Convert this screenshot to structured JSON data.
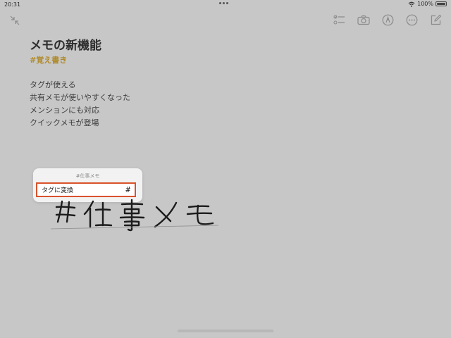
{
  "status_bar": {
    "time": "20:31",
    "battery_text": "100%",
    "icons": [
      "wifi-icon",
      "battery-icon"
    ]
  },
  "toolbar": {
    "icons": [
      "collapse-icon",
      "checklist-icon",
      "camera-icon",
      "markup-pen-icon",
      "more-icon",
      "compose-icon"
    ]
  },
  "note": {
    "title": "メモの新機能",
    "tag": "#覚え書き",
    "lines": [
      "タグが使える",
      "共有メモが使いやすくなった",
      "メンションにも対応",
      "クイックメモが登場"
    ]
  },
  "popup": {
    "preview_text": "#仕事メモ",
    "action_label": "タグに変換",
    "action_icon": "#"
  },
  "colors": {
    "background": "#c7c7c7",
    "tag_accent": "#b08a2a",
    "highlight_border": "#d9532c"
  }
}
